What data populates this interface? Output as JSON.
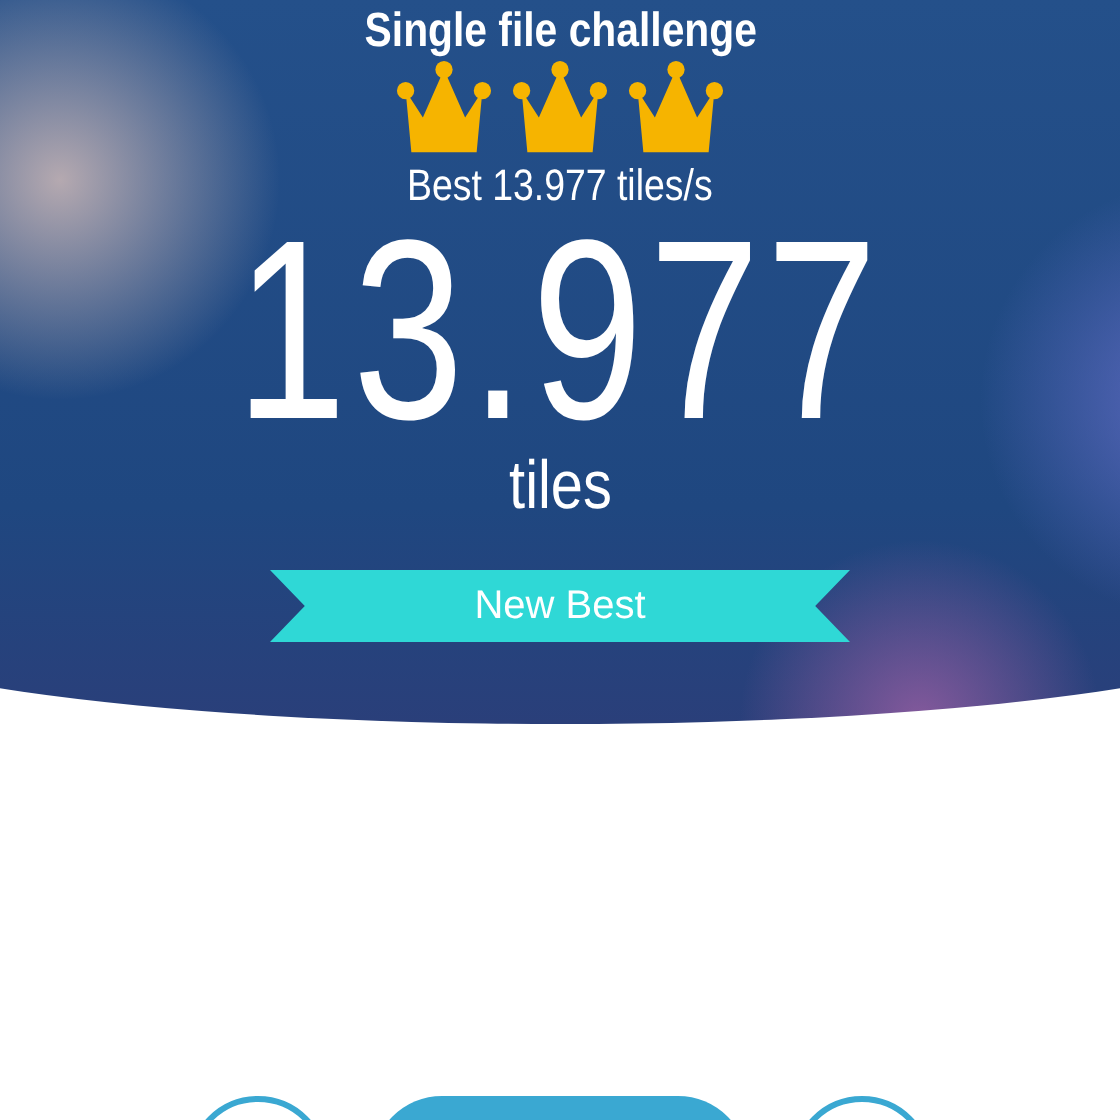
{
  "title": "Single file challenge",
  "crowns": {
    "stars": 3
  },
  "best": "Best 13.977 tiles/s",
  "score": "13.977",
  "unit": "tiles",
  "ribbon": "New Best",
  "bottom_buttons": [
    {
      "kind": "circle"
    },
    {
      "kind": "pill"
    },
    {
      "kind": "circle"
    }
  ]
}
